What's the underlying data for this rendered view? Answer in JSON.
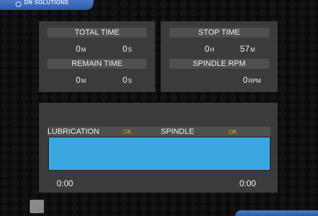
{
  "brand": {
    "text": "DN SOLUTIONS",
    "icon": "brand-logo-icon"
  },
  "total_time": {
    "label": "TOTAL TIME",
    "minutes": "0",
    "minutes_unit": "M",
    "seconds": "0",
    "seconds_unit": "S"
  },
  "remain_time": {
    "label": "REMAIN TIME",
    "minutes": "0",
    "minutes_unit": "M",
    "seconds": "0",
    "seconds_unit": "S"
  },
  "stop_time": {
    "label": "STOP TIME",
    "hours": "0",
    "hours_unit": "H",
    "minutes": "57",
    "minutes_unit": "M"
  },
  "spindle_rpm": {
    "label": "SPINDLE RPM",
    "value": "0",
    "unit": "RPM"
  },
  "status": {
    "lubrication_label": "LUBRICATION",
    "lubrication_state": "OK",
    "spindle_label": "SPINDLE",
    "spindle_state": "OK"
  },
  "progress": {
    "fraction": 1.0,
    "start_time": "0:00",
    "end_time": "0:00",
    "fill_color": "#3aa7e0"
  },
  "colors": {
    "accent": "#3aa7e0",
    "ok": "#e0b21a",
    "brand": "#2f5aa8"
  }
}
